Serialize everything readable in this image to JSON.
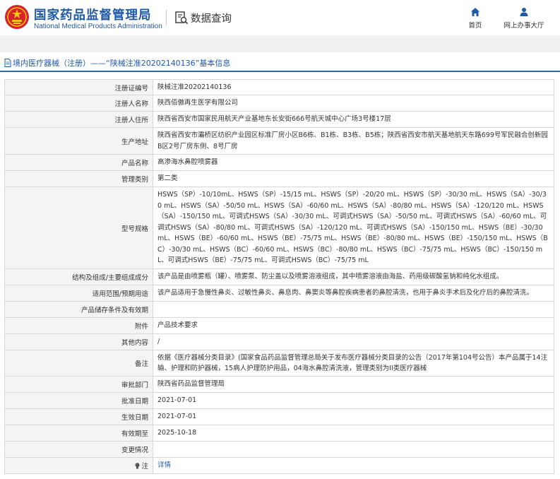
{
  "header": {
    "brand_cn": "国家药品监督管理局",
    "brand_en": "National Medical Products Administration",
    "section_title": "数据查询",
    "nav_home": "首页",
    "nav_office": "网上办事大厅",
    "brand_color": "#1f5aa8",
    "emblem_color": "#d8232a"
  },
  "breadcrumb": {
    "text": "境内医疗器械（注册）——“陕械注准20202140136”基本信息"
  },
  "rows": [
    {
      "label": "注册证编号",
      "value": "陕械注准20202140136"
    },
    {
      "label": "注册人名称",
      "value": "陕西佰傲再生医学有限公司"
    },
    {
      "label": "注册人住所",
      "value": "陕西省西安市国家民用航天产业基地东长安街666号航天城中心广场3号楼17层"
    },
    {
      "label": "生产地址",
      "value": "陕西省西安市灞桥区纺织产业园区标准厂房小区B6栋、B1栋、B3栋、B5栋；陕西省西安市航天基地航天东路699号军民融合创新园B区2号厂房东侧、8号厂房"
    },
    {
      "label": "产品名称",
      "value": "高渗海水鼻腔喷雾器"
    },
    {
      "label": "管理类别",
      "value": "第二类"
    },
    {
      "label": "型号规格",
      "value": "HSWS（SP）-10/10mL、HSWS（SP）-15/15 mL、HSWS（SP）-20/20 mL、HSWS（SP）-30/30 mL、HSWS（SA）-30/30 mL、HSWS（SA）-50/50 mL、HSWS（SA）-60/60 mL、HSWS（SA）-80/80 mL、HSWS（SA）-120/120 mL、HSWS（SA）-150/150 mL、可调式HSWS（SA）-30/30 mL、可调式HSWS（SA）-50/50 mL、可调式HSWS（SA）-60/60 mL、可调式HSWS（SA）-80/80 mL、可调式HSWS（SA）-120/120 mL、可调式HSWS（SA）-150/150 mL、HSWS（BE）-30/30 mL、HSWS（BE）-60/60 mL、HSWS（BE）-75/75 mL、HSWS（BE）-80/80 mL、HSWS（BE）-150/150 mL、HSWS（BC）-30/30 mL、HSWS（BC）-60/60 mL、HSWS（BC）-80/80 mL、HSWS（BC）-75/75 mL、HSWS（BC）-150/150 mL、可调式HSWS（BE）-75/75 mL、可调式HSWS（BC）-75/75 mL"
    },
    {
      "label": "结构及组成/主要组成成分",
      "value": "该产品是由喷雾瓶（罐）、喷雾泵、防尘盖以及喷雾溶液组成，其中喷雾溶液由海盐、药用级碳酸氢钠和纯化水组成。"
    },
    {
      "label": "适用范围/预期用途",
      "value": "该产品适用于急慢性鼻炎、过敏性鼻炎、鼻息肉、鼻窦炎等鼻腔疾病患者的鼻腔清洗，也用于鼻炎手术后及化疗后的鼻腔清洗。"
    },
    {
      "label": "产品储存条件及有效期",
      "value": ""
    },
    {
      "label": "附件",
      "value": "产品技术要求"
    },
    {
      "label": "其他内容",
      "value": "/"
    },
    {
      "label": "备注",
      "value": "依据《医疗器械分类目录》(国家食品药品监督管理总局关于发布医疗器械分类目录的公告（2017年第104号公告）本产品属于14注输、护理和防护器械，15病人护理防护用品，04海水鼻腔清洗液，管理类别为II类医疗器械"
    },
    {
      "label": "审批部门",
      "value": "陕西省药品监督管理局"
    },
    {
      "label": "批准日期",
      "value": "2021-07-01"
    },
    {
      "label": "生效日期",
      "value": "2021-07-01"
    },
    {
      "label": "有效期至",
      "value": "2025-10-18"
    },
    {
      "label": "变更情况",
      "value": ""
    }
  ],
  "note_row": {
    "label": "注",
    "link": "详情"
  }
}
